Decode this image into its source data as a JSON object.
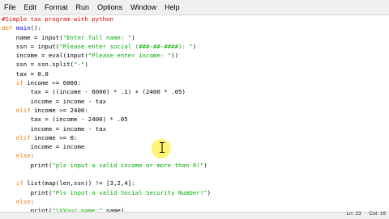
{
  "menu": [
    "File",
    "Edit",
    "Format",
    "Run",
    "Options",
    "Window",
    "Help"
  ],
  "colors": {
    "comment": "#dd0000",
    "keyword": "#ff7700",
    "definition": "#0000ff",
    "string": "#00aa00",
    "text": "#000000",
    "cursor_highlight": "#ffeb00"
  },
  "code_lines": [
    [
      [
        "comment",
        "#Simple tax program with python"
      ]
    ],
    [
      [
        "kw",
        "def "
      ],
      [
        "def",
        "main"
      ],
      [
        "plain",
        "():"
      ]
    ],
    [
      [
        "plain",
        "    name = input("
      ],
      [
        "str",
        "\"Enter full name: \""
      ],
      [
        "plain",
        ")"
      ]
    ],
    [
      [
        "plain",
        "    ssn = input("
      ],
      [
        "str",
        "\"Please enter social (###-##-####): \""
      ],
      [
        "plain",
        ")"
      ]
    ],
    [
      [
        "plain",
        "    income = eval(input("
      ],
      [
        "str",
        "\"Please enter income: \""
      ],
      [
        "plain",
        "))"
      ]
    ],
    [
      [
        "plain",
        "    ssn = ssn.split("
      ],
      [
        "str",
        "\"-\""
      ],
      [
        "plain",
        ")"
      ]
    ],
    [
      [
        "plain",
        "    tax = 0.0"
      ]
    ],
    [
      [
        "kw",
        "    if "
      ],
      [
        "plain",
        "income >= 6000:"
      ]
    ],
    [
      [
        "plain",
        "        tax = ((income - 6000) * .1) + (2400 * .05)"
      ]
    ],
    [
      [
        "plain",
        "        income = income - tax"
      ]
    ],
    [
      [
        "kw",
        "    elif "
      ],
      [
        "plain",
        "income >= 2400:"
      ]
    ],
    [
      [
        "plain",
        "        tax = (income - 2400) * .05"
      ]
    ],
    [
      [
        "plain",
        "        income = income - tax"
      ]
    ],
    [
      [
        "kw",
        "    elif "
      ],
      [
        "plain",
        "income >= 0:"
      ]
    ],
    [
      [
        "plain",
        "        income = income"
      ]
    ],
    [
      [
        "kw",
        "    else"
      ],
      [
        "plain",
        ":"
      ]
    ],
    [
      [
        "plain",
        "        print("
      ],
      [
        "str",
        "\"pls input a valid income or more than 0!\""
      ],
      [
        "plain",
        ")"
      ]
    ],
    [
      [
        "plain",
        ""
      ]
    ],
    [
      [
        "kw",
        "    if "
      ],
      [
        "plain",
        "list(map(len,ssn)) != [3,2,4]:"
      ]
    ],
    [
      [
        "plain",
        "        print("
      ],
      [
        "str",
        "\"Pls input a valid Social Security Number!\""
      ],
      [
        "plain",
        ")"
      ]
    ],
    [
      [
        "kw",
        "    else"
      ],
      [
        "plain",
        ":"
      ]
    ],
    [
      [
        "plain",
        "        print("
      ],
      [
        "str",
        "\"\\nYour name:\""
      ],
      [
        "plain",
        ",name)"
      ]
    ],
    [
      [
        "plain",
        "        print("
      ]
    ]
  ],
  "status": {
    "line": "Ln: 23",
    "col": "Col: 16"
  }
}
